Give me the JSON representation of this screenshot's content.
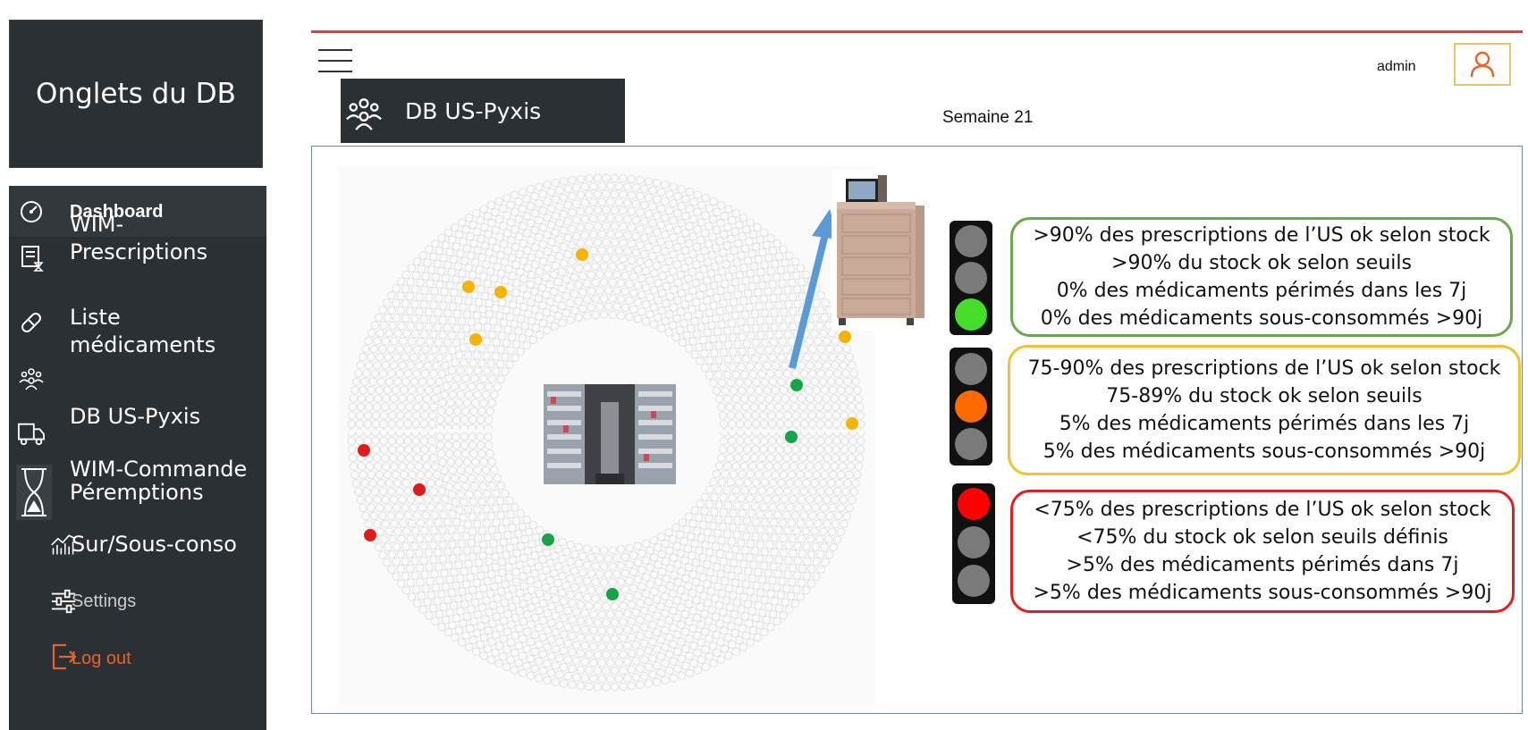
{
  "sidebar": {
    "title": "Onglets du DB",
    "items": [
      {
        "label": "Dashboard",
        "icon": "gauge-icon"
      },
      {
        "label": "WIM-\nPrescriptions",
        "icon": "prescription-icon"
      },
      {
        "label": "Liste\nmédicaments",
        "icon": "pill-icon"
      },
      {
        "label": "DB US-Pyxis",
        "icon": "people-icon"
      },
      {
        "label": "WIM-Commande",
        "icon": "truck-icon"
      },
      {
        "label": "Péremptions",
        "icon": "hourglass-icon"
      },
      {
        "label": "Sur/Sous-conso",
        "icon": "chart-icon"
      },
      {
        "label": "Settings",
        "icon": "sliders-icon"
      },
      {
        "label": "Log out",
        "icon": "logout-icon"
      }
    ]
  },
  "header": {
    "user": "admin",
    "tab_label": "DB US-Pyxis",
    "week": "Semaine 21"
  },
  "colors": {
    "sidebar_bg": "#2b3035",
    "logout": "#e8632a",
    "green": "#6aa84f",
    "orange": "#f1c232",
    "red": "#e02020",
    "dot_yellow": "#f4b400",
    "dot_green": "#17a34a",
    "dot_red": "#e01b1b"
  },
  "legend": [
    {
      "status": "green",
      "lines": [
        ">90% des prescriptions de l’US ok selon stock",
        ">90% du stock ok selon seuils",
        "0% des médicaments périmés dans les 7j",
        "0% des médicaments sous-consommés >90j"
      ]
    },
    {
      "status": "orange",
      "lines": [
        "75-90% des prescriptions de l’US ok selon stock",
        "75-89% du stock ok selon seuils",
        "5% des médicaments périmés dans les 7j",
        "5% des médicaments sous-consommés >90j"
      ]
    },
    {
      "status": "red",
      "lines": [
        "<75% des prescriptions de l’US ok selon stock",
        "<75% du stock ok selon seuils définis",
        ">5% des médicaments périmés dans 7j",
        ">5% des médicaments sous-consommés >90j"
      ]
    }
  ]
}
